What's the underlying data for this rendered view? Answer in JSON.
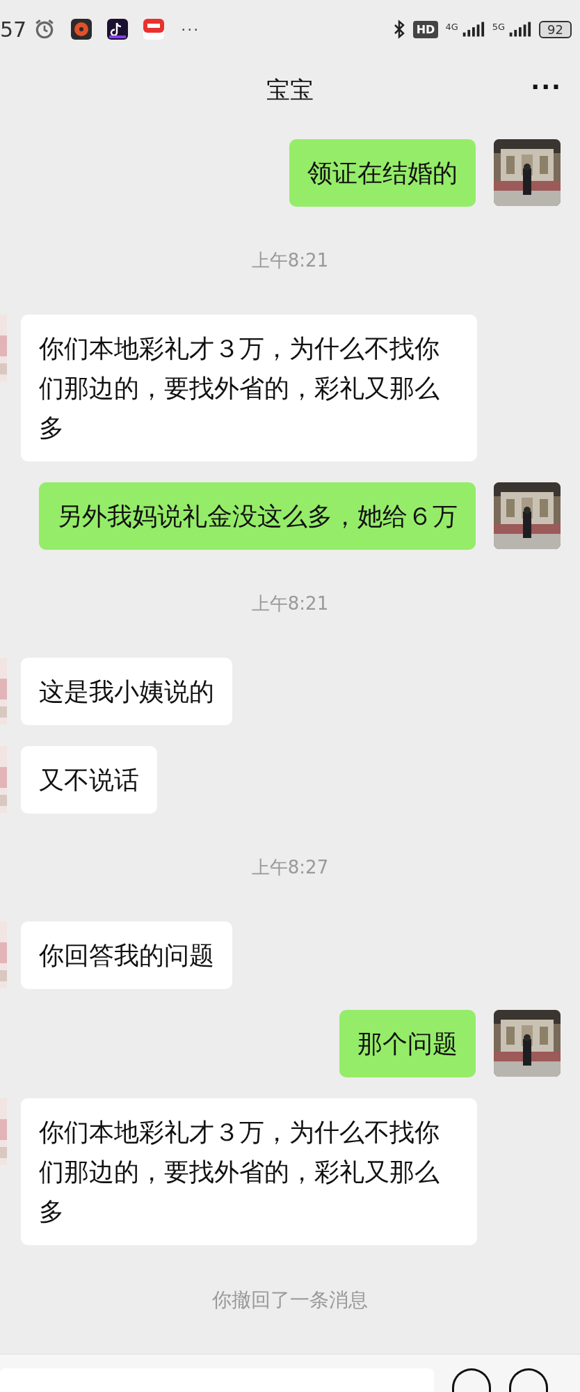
{
  "status_bar": {
    "time": "57",
    "more": "···",
    "hd": "HD",
    "network_1": "4G",
    "network_2": "5G",
    "battery": "92"
  },
  "header": {
    "title": "宝宝",
    "more": "···"
  },
  "messages": [
    {
      "kind": "sent",
      "text": "领证在结婚的"
    },
    {
      "kind": "time",
      "text": "上午8:21"
    },
    {
      "kind": "received",
      "text": "你们本地彩礼才３万，为什么不找你们那边的，要找外省的，彩礼又那么多"
    },
    {
      "kind": "sent",
      "text": "另外我妈说礼金没这么多，她给６万"
    },
    {
      "kind": "time",
      "text": "上午8:21"
    },
    {
      "kind": "received",
      "text": "这是我小姨说的"
    },
    {
      "kind": "received",
      "text": "又不说话"
    },
    {
      "kind": "time",
      "text": "上午8:27"
    },
    {
      "kind": "received",
      "text": "你回答我的问题"
    },
    {
      "kind": "sent",
      "text": "那个问题"
    },
    {
      "kind": "received",
      "text": "你们本地彩礼才３万，为什么不找你们那边的，要找外省的，彩礼又那么多"
    },
    {
      "kind": "notice",
      "text": "你撤回了一条消息"
    }
  ]
}
